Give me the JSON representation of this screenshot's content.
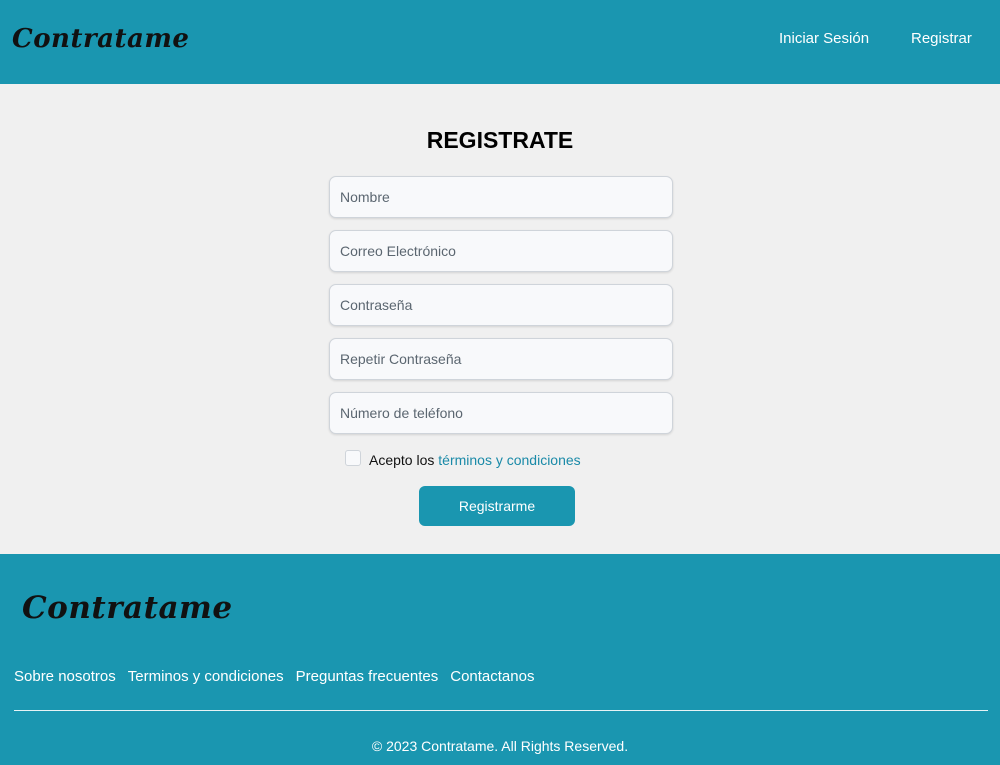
{
  "header": {
    "logo": "Contratame",
    "nav": {
      "login": "Iniciar Sesión",
      "register": "Registrar"
    }
  },
  "form": {
    "title": "REGISTRATE",
    "fields": {
      "name_placeholder": "Nombre",
      "email_placeholder": "Correo Electrónico",
      "password_placeholder": "Contraseña",
      "repeat_password_placeholder": "Repetir Contraseña",
      "phone_placeholder": "Número de teléfono"
    },
    "terms": {
      "prefix": "Acepto los",
      "link": "términos y condiciones",
      "checked": false
    },
    "submit_label": "Registrarme"
  },
  "footer": {
    "logo": "Contratame",
    "links": [
      "Sobre nosotros",
      "Terminos y condiciones",
      "Preguntas frecuentes",
      "Contactanos"
    ],
    "copyright": "© 2023 Contratame. All Rights Reserved."
  },
  "colors": {
    "brand": "#1a96b0",
    "background": "#f0f0f0",
    "link": "#1a8aa8"
  }
}
